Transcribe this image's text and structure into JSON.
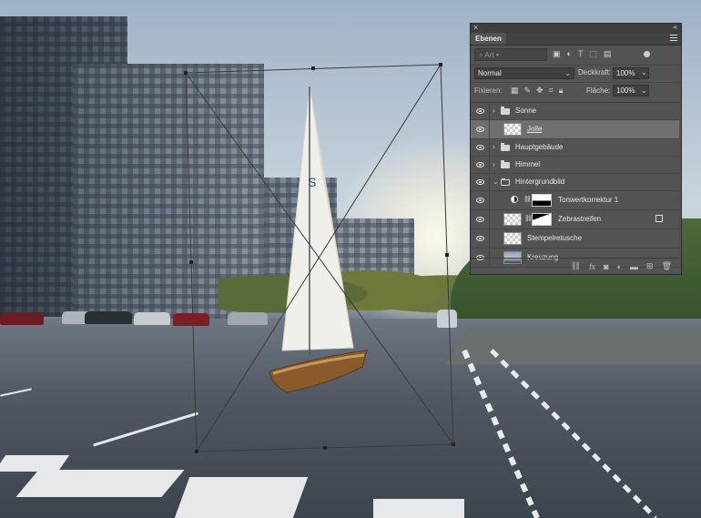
{
  "panel": {
    "title_tab": "Ebenen",
    "filter": {
      "placeholder": "Art"
    },
    "blend_mode": "Normal",
    "opacity_label": "Deckkraft:",
    "opacity_value": "100%",
    "lock_label": "Fixieren:",
    "fill_label": "Fläche:",
    "fill_value": "100%",
    "layers": [
      {
        "name": "Sonne",
        "type": "group",
        "expanded": false
      },
      {
        "name": "Jolle",
        "type": "smart-object",
        "selected": true
      },
      {
        "name": "Hauptgebäude",
        "type": "group",
        "expanded": false
      },
      {
        "name": "Himmel",
        "type": "group",
        "expanded": false
      },
      {
        "name": "Hintergrundbild",
        "type": "group",
        "expanded": true
      },
      {
        "name": "Tonwertkorrektur 1",
        "type": "adjustment"
      },
      {
        "name": "Zebrastreifen",
        "type": "smart-object"
      },
      {
        "name": "Stempelretusche",
        "type": "pixel"
      },
      {
        "name": "Kreuzung",
        "type": "pixel"
      }
    ],
    "bottom_icons": [
      "link-icon",
      "fx-icon",
      "mask-icon",
      "adjustment-icon",
      "folder-icon",
      "new-layer-icon",
      "trash-icon"
    ]
  },
  "colors": {
    "panel_bg": "#535353",
    "selected_row": "#6f6f6f",
    "transform_box": "#3b3b3b"
  }
}
